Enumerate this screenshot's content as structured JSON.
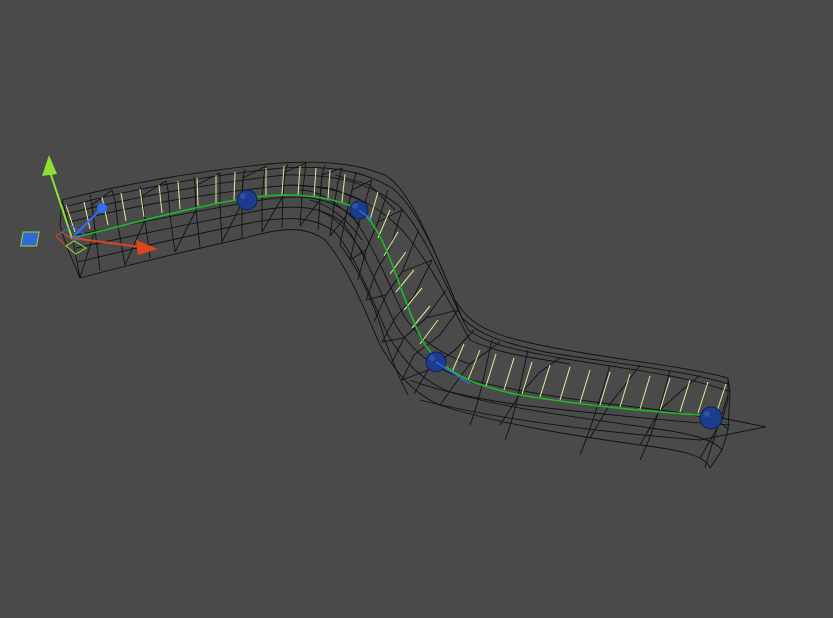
{
  "viewport": {
    "background": "#4a4a4a"
  },
  "colors": {
    "wireframe": "#111111",
    "spline": "#1fb82a",
    "ticks": "#e6e89a",
    "control_point": "#1c3c8c",
    "axis_x": "#e0441f",
    "axis_y": "#8ede34",
    "axis_z": "#2f6cff"
  },
  "gizmo": {
    "icons": [
      "move-gizmo-icon"
    ]
  }
}
